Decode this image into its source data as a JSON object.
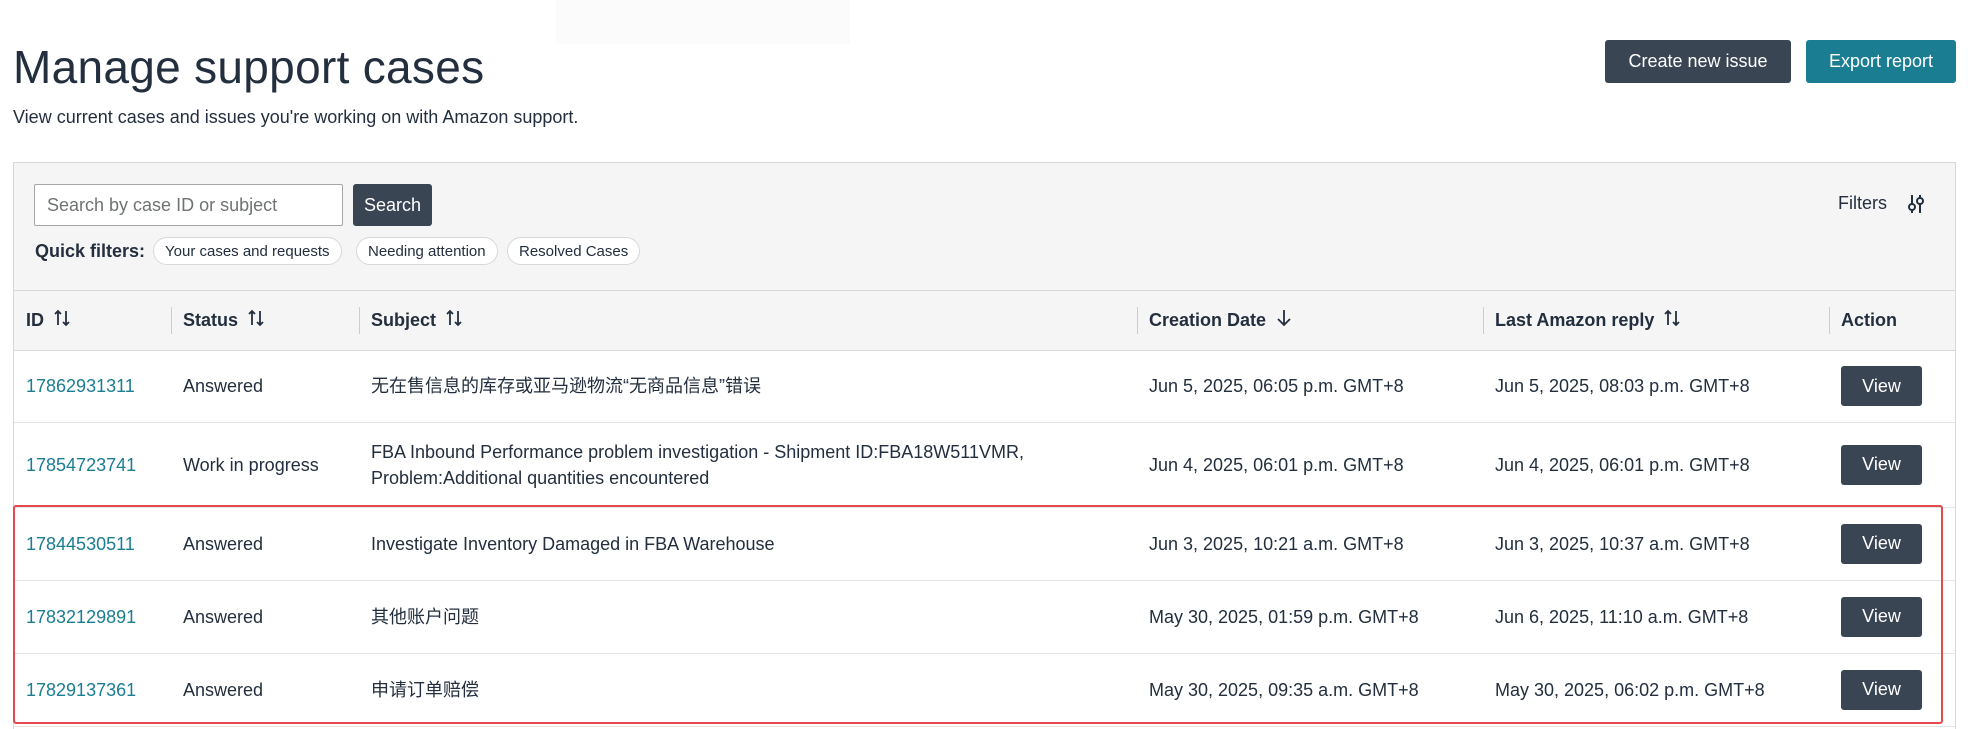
{
  "page": {
    "title": "Manage support cases",
    "subtitle": "View current cases and issues you're working on with Amazon support."
  },
  "actions": {
    "create_label": "Create new issue",
    "export_label": "Export report"
  },
  "search": {
    "placeholder": "Search by case ID or subject",
    "value": "",
    "button_label": "Search"
  },
  "quick_filters": {
    "label": "Quick filters:",
    "chips": [
      "Your cases and requests",
      "Needing attention",
      "Resolved Cases"
    ]
  },
  "filters": {
    "label": "Filters",
    "icon": "sliders-icon"
  },
  "table": {
    "columns": [
      {
        "label": "ID",
        "sort": "sortable"
      },
      {
        "label": "Status",
        "sort": "sortable"
      },
      {
        "label": "Subject",
        "sort": "sortable"
      },
      {
        "label": "Creation Date",
        "sort": "descending"
      },
      {
        "label": "Last Amazon reply",
        "sort": "sortable"
      },
      {
        "label": "Action",
        "sort": "none"
      }
    ],
    "rows": [
      {
        "id": "17862931311",
        "status": "Answered",
        "subject": "无在售信息的库存或亚马逊物流“无商品信息”错误",
        "created": "Jun 5, 2025, 06:05 p.m. GMT+8",
        "last_reply": "Jun 5, 2025, 08:03 p.m. GMT+8",
        "action": "View"
      },
      {
        "id": "17854723741",
        "status": "Work in progress",
        "subject": "FBA Inbound Performance problem investigation - Shipment ID:FBA18W511VMR, Problem:Additional quantities encountered",
        "created": "Jun 4, 2025, 06:01 p.m. GMT+8",
        "last_reply": "Jun 4, 2025, 06:01 p.m. GMT+8",
        "action": "View"
      },
      {
        "id": "17844530511",
        "status": "Answered",
        "subject": "Investigate Inventory Damaged in FBA Warehouse",
        "created": "Jun 3, 2025, 10:21 a.m. GMT+8",
        "last_reply": "Jun 3, 2025, 10:37 a.m. GMT+8",
        "action": "View"
      },
      {
        "id": "17832129891",
        "status": "Answered",
        "subject": "其他账户问题",
        "created": "May 30, 2025, 01:59 p.m. GMT+8",
        "last_reply": "Jun 6, 2025, 11:10 a.m. GMT+8",
        "action": "View"
      },
      {
        "id": "17829137361",
        "status": "Answered",
        "subject": "申请订单赔偿",
        "created": "May 30, 2025, 09:35 a.m. GMT+8",
        "last_reply": "May 30, 2025, 06:02 p.m. GMT+8",
        "action": "View"
      }
    ]
  },
  "colors": {
    "primary_button": "#3a4553",
    "accent": "#1a7d92",
    "highlight": "#e5484d"
  }
}
